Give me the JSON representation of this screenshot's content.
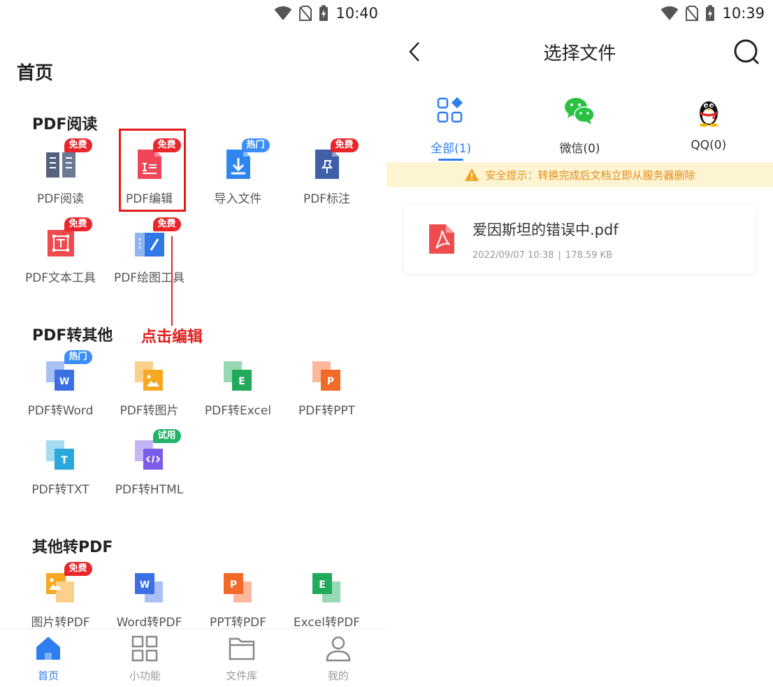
{
  "left": {
    "status": {
      "time": "10:40"
    },
    "page_title": "首页",
    "sections": [
      {
        "title": "PDF阅读",
        "items": [
          {
            "label": "PDF阅读",
            "icon": "pdf-read-icon",
            "badge": "免费",
            "badge_color": "red"
          },
          {
            "label": "PDF编辑",
            "icon": "pdf-edit-icon",
            "badge": "免费",
            "badge_color": "red"
          },
          {
            "label": "导入文件",
            "icon": "import-file-icon",
            "badge": "热门",
            "badge_color": "blue"
          },
          {
            "label": "PDF标注",
            "icon": "pdf-annotate-icon",
            "badge": "免费",
            "badge_color": "red"
          },
          {
            "label": "PDF文本工具",
            "icon": "pdf-text-tool-icon",
            "badge": "免费",
            "badge_color": "red"
          },
          {
            "label": "PDF绘图工具",
            "icon": "pdf-draw-tool-icon",
            "badge": "免费",
            "badge_color": "red"
          }
        ]
      },
      {
        "title": "PDF转其他",
        "items": [
          {
            "label": "PDF转Word",
            "icon": "pdf-to-word-icon",
            "badge": "热门",
            "badge_color": "blue"
          },
          {
            "label": "PDF转图片",
            "icon": "pdf-to-image-icon",
            "badge": "",
            "badge_color": ""
          },
          {
            "label": "PDF转Excel",
            "icon": "pdf-to-excel-icon",
            "badge": "",
            "badge_color": ""
          },
          {
            "label": "PDF转PPT",
            "icon": "pdf-to-ppt-icon",
            "badge": "",
            "badge_color": ""
          },
          {
            "label": "PDF转TXT",
            "icon": "pdf-to-txt-icon",
            "badge": "",
            "badge_color": ""
          },
          {
            "label": "PDF转HTML",
            "icon": "pdf-to-html-icon",
            "badge": "试用",
            "badge_color": "green"
          }
        ]
      },
      {
        "title": "其他转PDF",
        "items": [
          {
            "label": "图片转PDF",
            "icon": "image-to-pdf-icon",
            "badge": "免费",
            "badge_color": "red"
          },
          {
            "label": "Word转PDF",
            "icon": "word-to-pdf-icon",
            "badge": "",
            "badge_color": ""
          },
          {
            "label": "PPT转PDF",
            "icon": "ppt-to-pdf-icon",
            "badge": "",
            "badge_color": ""
          },
          {
            "label": "Excel转PDF",
            "icon": "excel-to-pdf-icon",
            "badge": "",
            "badge_color": ""
          }
        ]
      }
    ],
    "annotation": "点击编辑",
    "bottom_nav": [
      {
        "label": "首页",
        "icon": "home-icon",
        "active": true
      },
      {
        "label": "小功能",
        "icon": "grid-icon",
        "active": false
      },
      {
        "label": "文件库",
        "icon": "folder-icon",
        "active": false
      },
      {
        "label": "我的",
        "icon": "user-icon",
        "active": false
      }
    ]
  },
  "right": {
    "status": {
      "time": "10:39"
    },
    "header": {
      "title": "选择文件"
    },
    "tabs": [
      {
        "label": "全部(1)",
        "icon": "all-files-icon",
        "active": true
      },
      {
        "label": "微信(0)",
        "icon": "wechat-icon",
        "active": false
      },
      {
        "label": "QQ(0)",
        "icon": "qq-icon",
        "active": false
      }
    ],
    "notice": "安全提示：转换完成后文档立即从服务器删除",
    "files": [
      {
        "name": "爱因斯坦的错误中.pdf",
        "date": "2022/09/07 10:38",
        "separator": "|",
        "size": "178.59 KB"
      }
    ]
  },
  "colors": {
    "accent": "#2f7ef0",
    "badge_red": "#e8262b",
    "badge_blue": "#3a8ef6",
    "badge_green": "#23b26a",
    "notice_bg": "#fdf4d2",
    "notice_text": "#e68b18"
  }
}
